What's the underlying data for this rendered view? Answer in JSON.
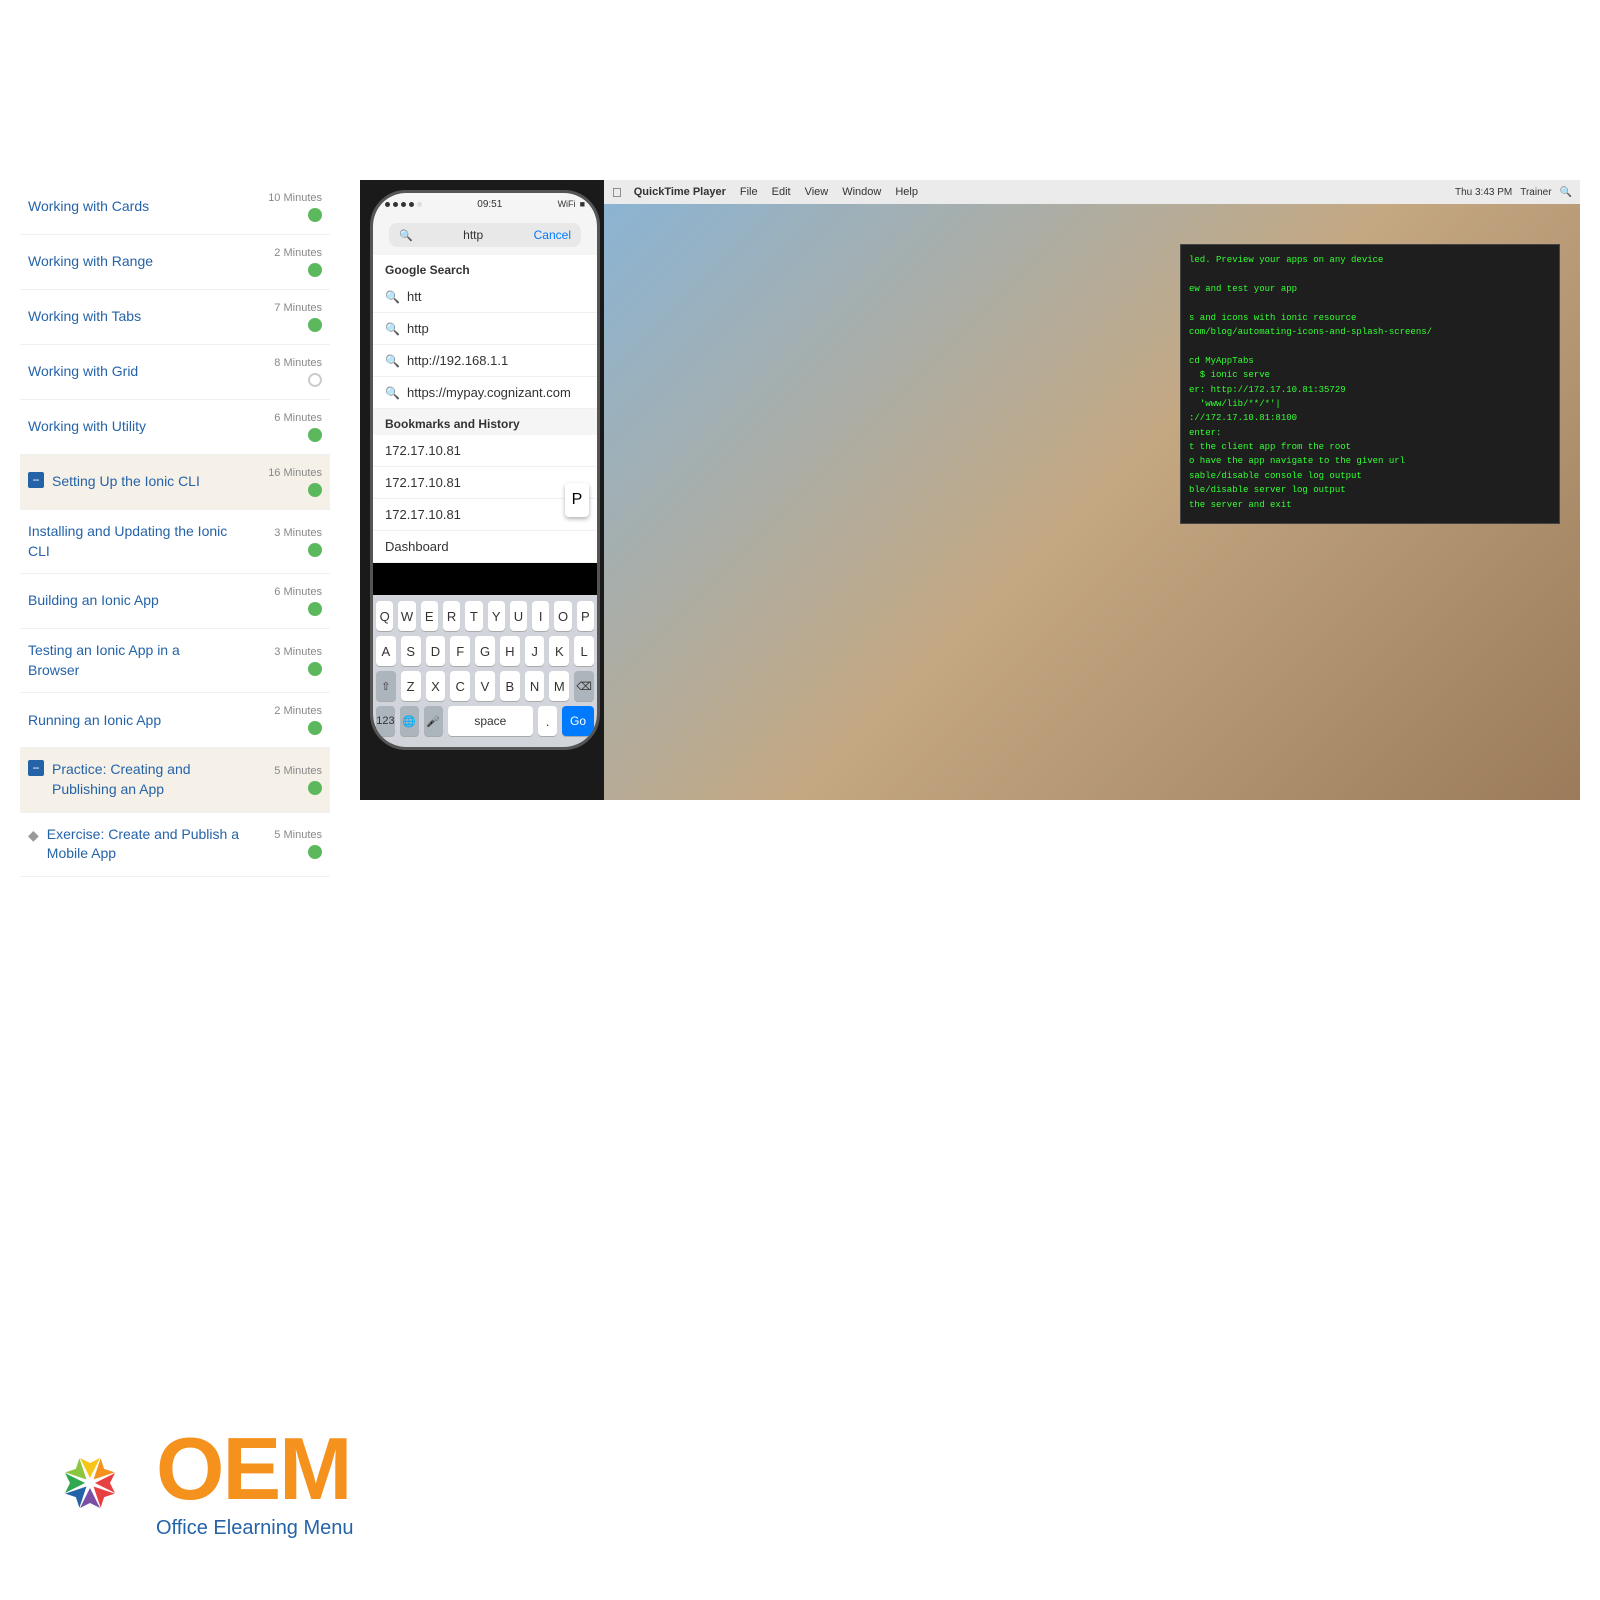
{
  "topSpace": 160,
  "sidebar": {
    "items": [
      {
        "id": "working-with-cards",
        "label": "Working with Cards",
        "minutes": "10 Minutes",
        "status": "green",
        "active": false,
        "hasIcon": false
      },
      {
        "id": "working-with-range",
        "label": "Working with Range",
        "minutes": "2 Minutes",
        "status": "green",
        "active": false,
        "hasIcon": false
      },
      {
        "id": "working-with-tabs",
        "label": "Working with Tabs",
        "minutes": "7 Minutes",
        "status": "green",
        "active": false,
        "hasIcon": false
      },
      {
        "id": "working-with-grid",
        "label": "Working with Grid",
        "minutes": "8 Minutes",
        "status": "empty",
        "active": false,
        "hasIcon": false
      },
      {
        "id": "working-with-utility",
        "label": "Working with Utility",
        "minutes": "6 Minutes",
        "status": "green",
        "active": false,
        "hasIcon": false
      },
      {
        "id": "setting-up-ionic-cli",
        "label": "Setting Up the Ionic CLI",
        "minutes": "16 Minutes",
        "status": "green",
        "active": true,
        "hasIcon": true
      },
      {
        "id": "installing-ionic-cli",
        "label": "Installing and Updating the Ionic CLI",
        "minutes": "3 Minutes",
        "status": "green",
        "active": false,
        "hasIcon": false
      },
      {
        "id": "building-ionic-app",
        "label": "Building an Ionic App",
        "minutes": "6 Minutes",
        "status": "green",
        "active": false,
        "hasIcon": false
      },
      {
        "id": "testing-ionic-app",
        "label": "Testing an Ionic App in a Browser",
        "minutes": "3 Minutes",
        "status": "green",
        "active": false,
        "hasIcon": false
      },
      {
        "id": "running-ionic-app",
        "label": "Running an Ionic App",
        "minutes": "2 Minutes",
        "status": "green",
        "active": false,
        "hasIcon": false
      },
      {
        "id": "practice-creating-app",
        "label": "Practice: Creating and Publishing an App",
        "minutes": "5 Minutes",
        "status": "green",
        "active": true,
        "hasIcon": true
      },
      {
        "id": "exercise-create-publish",
        "label": "Exercise: Create and Publish a Mobile App",
        "minutes": "5 Minutes",
        "status": "green",
        "active": false,
        "hasIcon": false
      }
    ]
  },
  "video": {
    "mac_menubar": [
      "QuickTime Player",
      "File",
      "Edit",
      "View",
      "Window",
      "Help"
    ],
    "mac_time": "Thu 3:43 PM",
    "mac_user": "Trainer",
    "url_value": "http",
    "cancel_label": "Cancel",
    "google_search_label": "Google Search",
    "suggestions": [
      "htt",
      "http",
      "http://192.168.1.1",
      "https://mypay.cognizant.com"
    ],
    "bookmarks_header": "Bookmarks and History",
    "bookmarks": [
      "172.17.10.81",
      "172.17.10.81",
      "172.17.10.81",
      "Dashboard"
    ],
    "keyboard_rows": [
      [
        "Q",
        "W",
        "E",
        "R",
        "T",
        "Y",
        "U",
        "I",
        "O",
        "P"
      ],
      [
        "A",
        "S",
        "D",
        "F",
        "G",
        "H",
        "J",
        "K",
        "L"
      ],
      [
        "Z",
        "X",
        "C",
        "V",
        "B",
        "N",
        "M"
      ]
    ],
    "keyboard_special": [
      "123",
      "🌐",
      "🎤",
      "space",
      ".",
      "Go"
    ],
    "terminal_lines": [
      "led. Preview your apps on any device",
      "",
      "ew and test your app",
      "",
      "s and icons with ionic resource",
      "com/blog/automating-icons-and-splash-screens/",
      "",
      "cd MyAppTabs",
      "$ ionic serve",
      "er: http://172.17.10.81:35729",
      "'www/lib/**/*'|",
      "://172.17.10.81:8100",
      "enter:",
      "t the client app from the root",
      "o have the app navigate to the given url",
      "sable/disable console log output",
      "ble/disable server log output",
      "the server and exit"
    ]
  },
  "logo": {
    "oem_text": "OEM",
    "subtitle": "Office Elearning Menu",
    "icon_colors": [
      "#e84040",
      "#f5921e",
      "#f5c518",
      "#8cc540",
      "#2fa84f",
      "#2563a8",
      "#7b4fa6",
      "#e84040",
      "#f5921e"
    ]
  }
}
